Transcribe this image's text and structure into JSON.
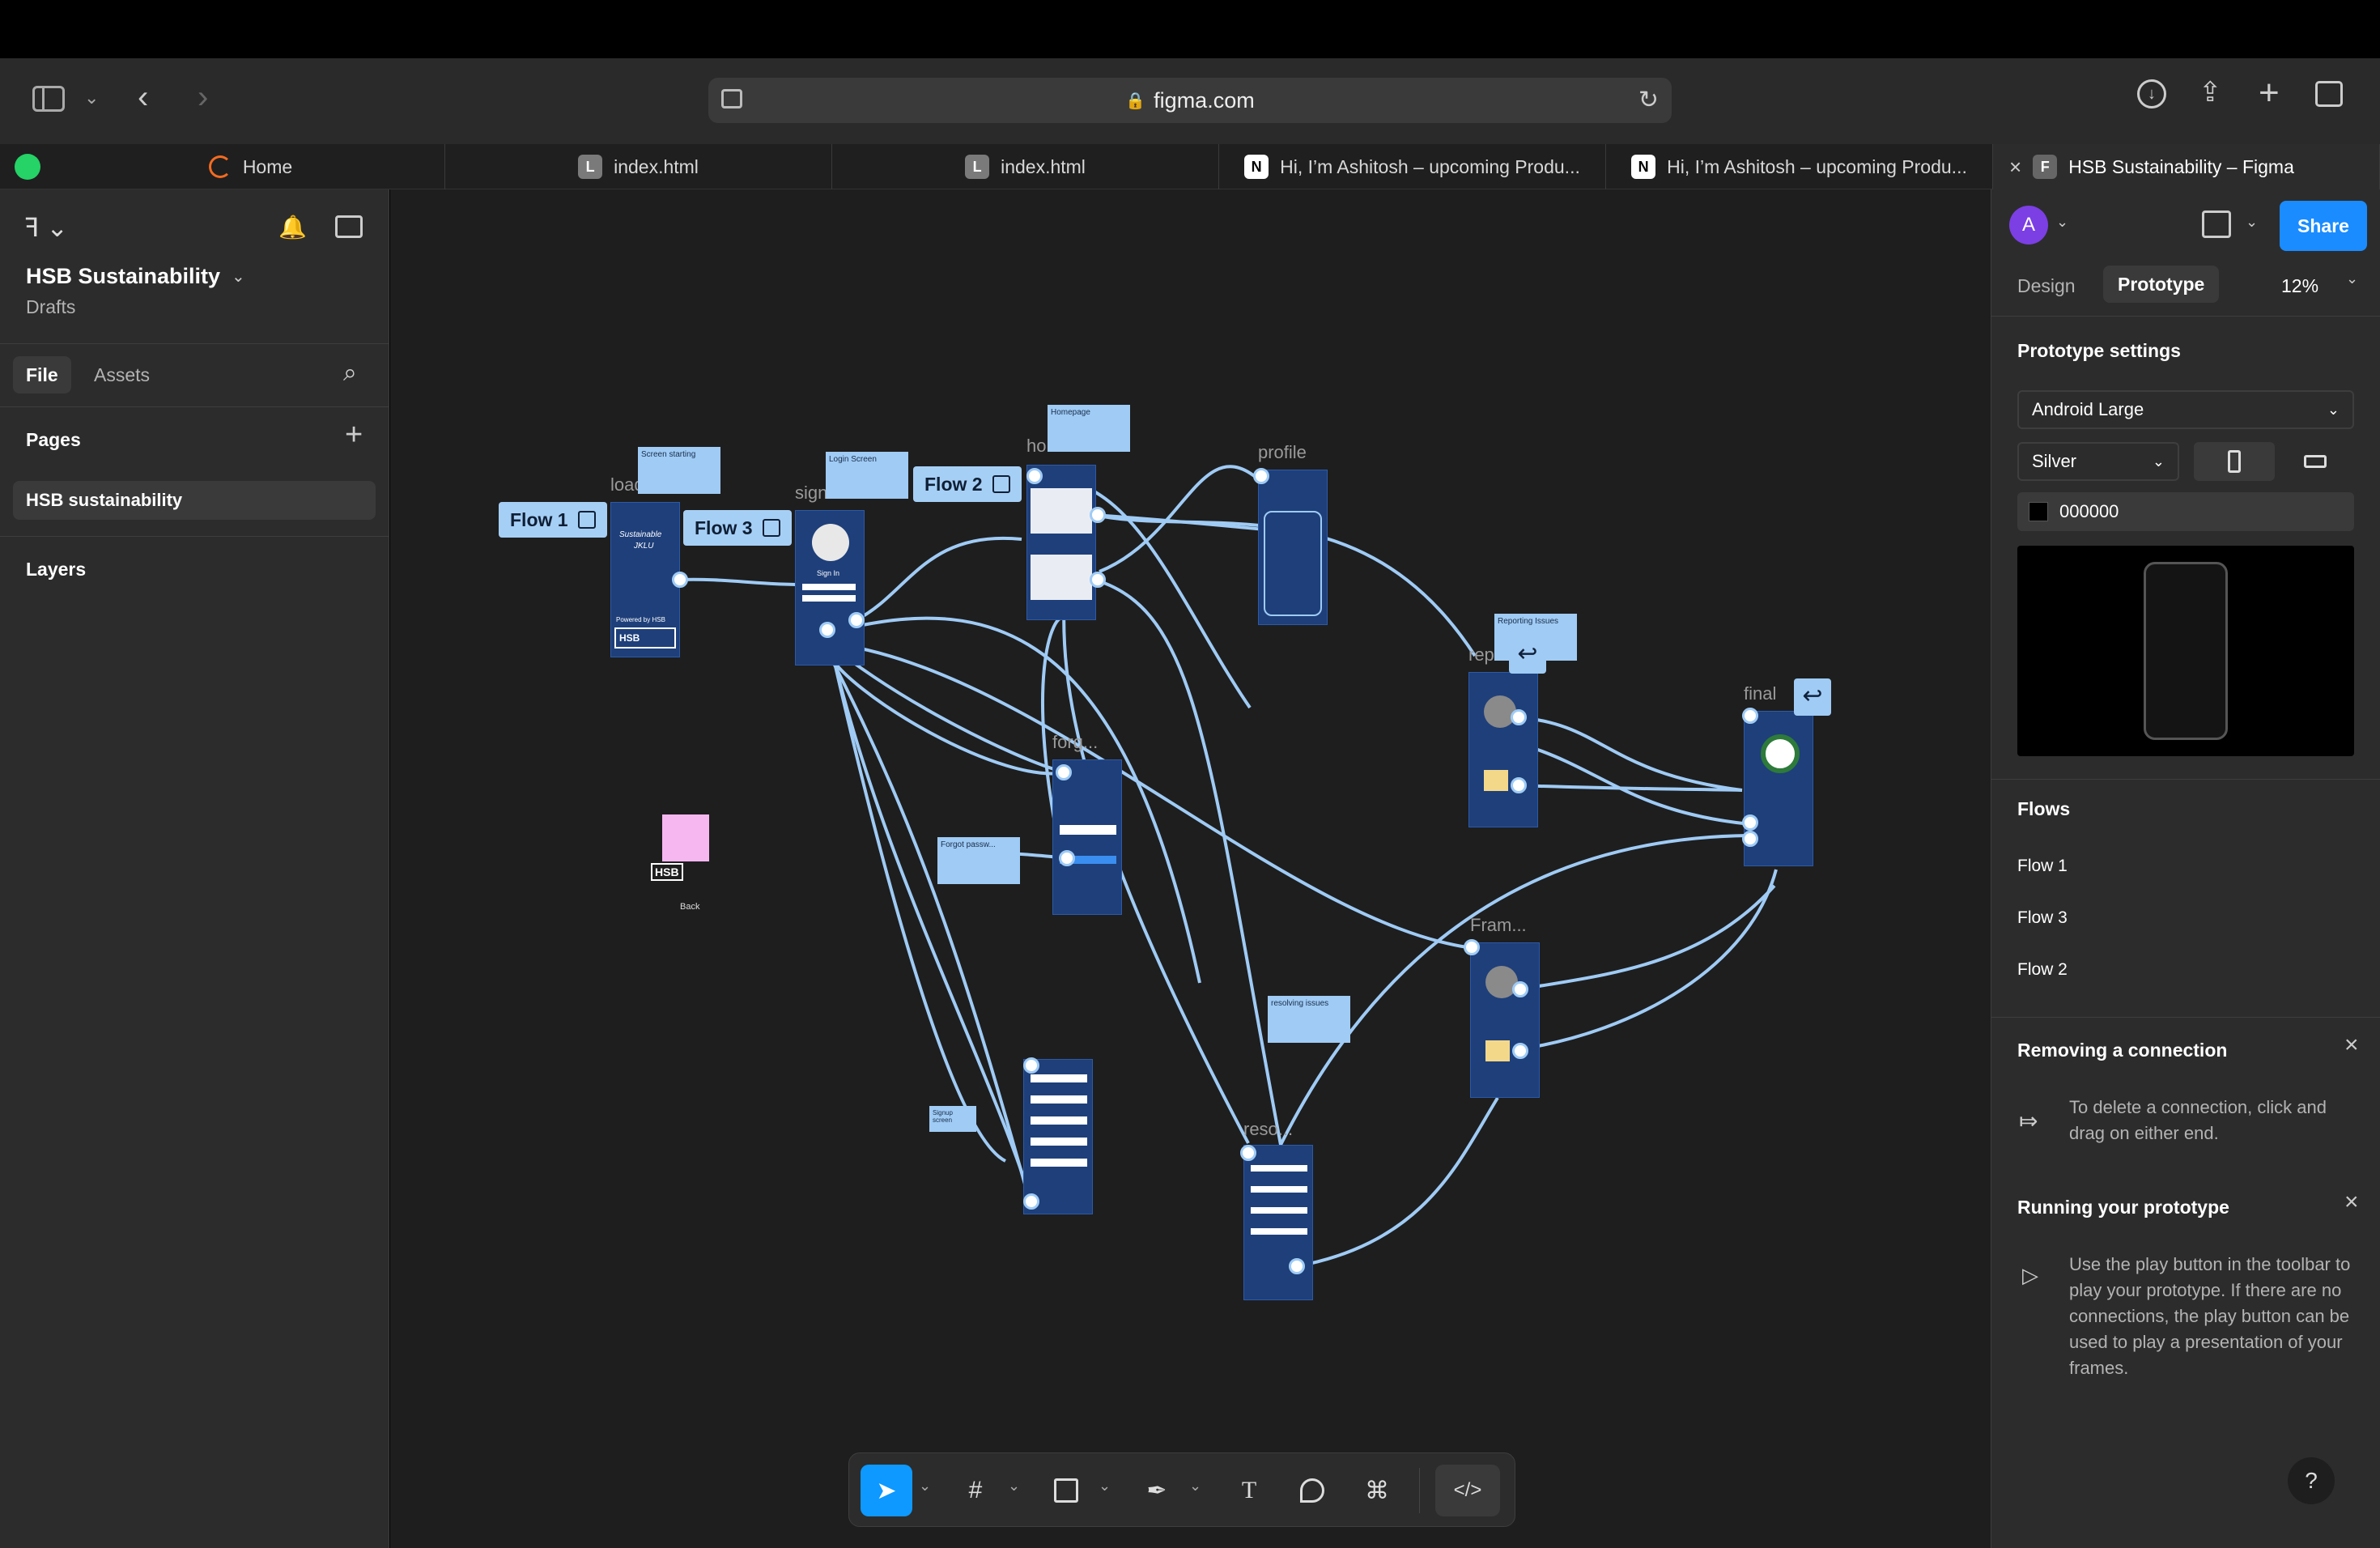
{
  "browser": {
    "url": "figma.com",
    "tabs": [
      {
        "label": "Home"
      },
      {
        "label": "index.html"
      },
      {
        "label": "index.html"
      },
      {
        "label": "Hi, I’m Ashitosh – upcoming Produ..."
      },
      {
        "label": "Hi, I’m Ashitosh – upcoming Produ..."
      },
      {
        "label": "HSB Sustainability – Figma"
      }
    ]
  },
  "left_panel": {
    "file_name": "HSB Sustainability",
    "location": "Drafts",
    "tab_file": "File",
    "tab_assets": "Assets",
    "pages_title": "Pages",
    "pages": [
      "HSB sustainability"
    ],
    "layers_title": "Layers"
  },
  "canvas": {
    "flows": [
      "Flow 1",
      "Flow 3",
      "Flow 2"
    ],
    "frame_labels": {
      "loading": "load...",
      "signin": "sign...",
      "home": "home...",
      "profile": "profile",
      "forgot": "forg...",
      "report": "rep...",
      "final": "final",
      "frame": "Fram...",
      "resolve": "reso..."
    },
    "stickies": {
      "homepage": "Homepage",
      "screen_starting": "Screen starting",
      "login_screen": "Login Screen",
      "reporting_issues": "Reporting Issues",
      "forgot_password": "Forgot passw...",
      "resolving_issues": "resolving issues",
      "signup_screen": "Signup screen"
    },
    "stray": {
      "back": "Back",
      "hsb": "HSB"
    },
    "splash": {
      "line1": "Sustainable",
      "line2": "JKLU",
      "powered": "Powered by HSB",
      "logo": "HSB"
    },
    "signin_text": "Sign In"
  },
  "right_panel": {
    "avatar_letter": "A",
    "share_label": "Share",
    "tab_design": "Design",
    "tab_prototype": "Prototype",
    "zoom": "12%",
    "settings_title": "Prototype settings",
    "device": "Android Large",
    "color_model": "Silver",
    "bg_hex": "000000",
    "flows_title": "Flows",
    "flows": [
      "Flow 1",
      "Flow 3",
      "Flow 2"
    ],
    "tip1_title": "Removing a connection",
    "tip1_body": "To delete a connection, click and drag on either end.",
    "tip2_title": "Running your prototype",
    "tip2_body": "Use the play button in the toolbar to play your prototype. If there are no connections, the play button can be used to play a presentation of your frames."
  },
  "colors": {
    "accent": "#0d99ff",
    "share": "#1a8cff",
    "frame": "#1e3f7a",
    "connector": "#9fcbf5",
    "avatar": "#7b3fe4"
  }
}
